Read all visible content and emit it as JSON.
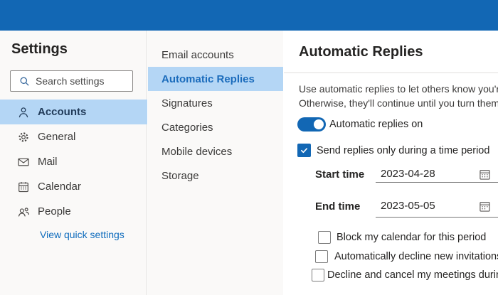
{
  "colors": {
    "accent_blue": "#1267b4",
    "selection_highlight": "#b4d6f5",
    "link_blue": "#0f6cbd",
    "selected_nav_text": "#1b6cbc"
  },
  "sidebar": {
    "title": "Settings",
    "search": {
      "placeholder": "Search settings"
    },
    "items": [
      {
        "label": "Accounts",
        "icon": "person-icon",
        "selected": true
      },
      {
        "label": "General",
        "icon": "gear-icon",
        "selected": false
      },
      {
        "label": "Mail",
        "icon": "mail-icon",
        "selected": false
      },
      {
        "label": "Calendar",
        "icon": "calendar-icon",
        "selected": false
      },
      {
        "label": "People",
        "icon": "people-icon",
        "selected": false
      }
    ],
    "quick_settings_link": "View quick settings"
  },
  "nav": {
    "items": [
      "Email accounts",
      "Automatic Replies",
      "Signatures",
      "Categories",
      "Mobile devices",
      "Storage"
    ],
    "selected": "Automatic Replies"
  },
  "panel": {
    "title": "Automatic Replies",
    "description_line1": "Use automatic replies to let others know you're",
    "description_line2": "Otherwise, they'll continue until you turn them o",
    "toggle": {
      "label": "Automatic replies on",
      "state": "on"
    },
    "time_period_checkbox": {
      "label": "Send replies only during a time period",
      "checked": true
    },
    "start_time": {
      "label": "Start time",
      "value": "2023-04-28"
    },
    "end_time": {
      "label": "End time",
      "value": "2023-05-05"
    },
    "options": [
      {
        "label": "Block my calendar for this period",
        "checked": false
      },
      {
        "label": "Automatically decline new invitations f",
        "checked": false
      },
      {
        "label": "Decline and cancel my meetings during",
        "checked": false
      }
    ]
  }
}
